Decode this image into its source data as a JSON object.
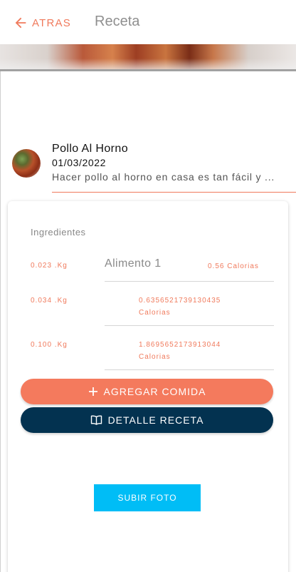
{
  "header": {
    "back_label": "ATRAS",
    "title": "Receta"
  },
  "recipe": {
    "name": "Pollo Al Horno",
    "date": "01/03/2022",
    "description": "Hacer pollo al horno en casa es tan fácil y ..."
  },
  "ingredients": {
    "label": "Ingredientes",
    "items": [
      {
        "quantity": "0.023 .Kg",
        "name": "Alimento 1",
        "calories": "0.56 Calorias"
      },
      {
        "quantity": "0.034 .Kg",
        "name": "",
        "calories_value": "0.6356521739130435",
        "calories_unit": "Calorias"
      },
      {
        "quantity": "0.100 .Kg",
        "name": "",
        "calories_value": "1.8695652173913044",
        "calories_unit": "Calorias"
      }
    ]
  },
  "actions": {
    "add_label": "AGREGAR COMIDA",
    "detail_label": "DETALLE RECETA",
    "upload_label": "SUBIR FOTO"
  },
  "colors": {
    "accent": "#f47a5d",
    "dark": "#033250",
    "upload": "#00bdf6"
  },
  "icons": {
    "back": "arrow-left-icon",
    "add": "plus-icon",
    "detail": "book-open-icon"
  }
}
